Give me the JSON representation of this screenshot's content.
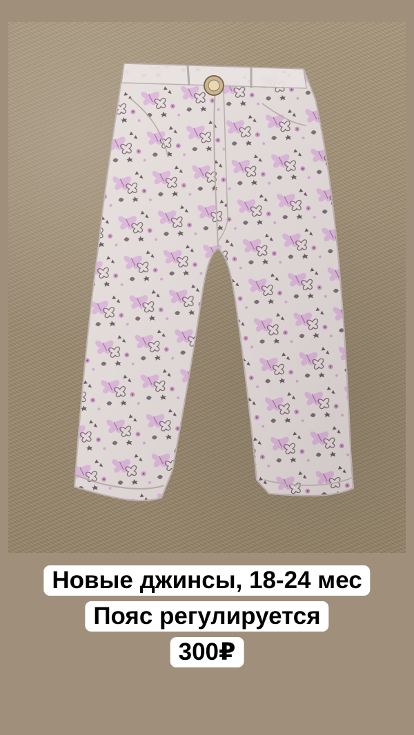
{
  "story": {
    "caption_line_1": "Новые джинсы, 18-24 мес",
    "caption_line_2": "Пояс регулируется",
    "caption_line_3": "300₽"
  },
  "colors": {
    "background": "#9f8f7b",
    "carpet": "#a08f76",
    "fabric": "#e7e1df",
    "print_pink": "#d9a8db",
    "print_dark": "#5d4b57",
    "caption_bg": "#ffffff",
    "caption_text": "#000000"
  },
  "photo": {
    "subject": "pants-photo"
  }
}
